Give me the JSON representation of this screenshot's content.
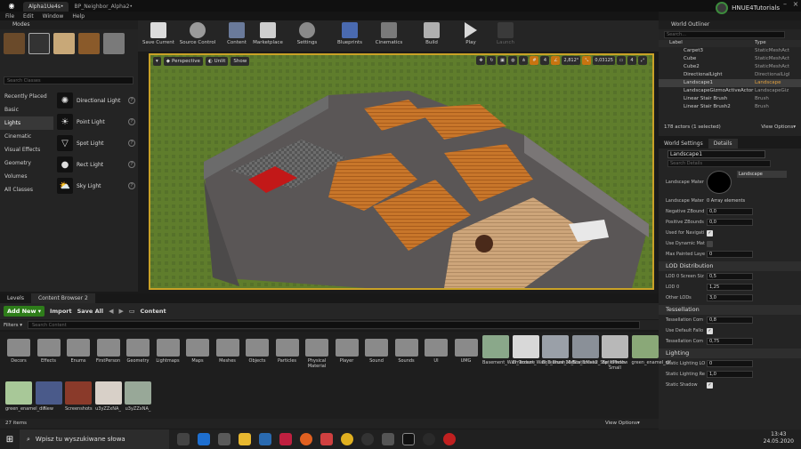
{
  "titlebar": {
    "tab1": "Alpha1Ue4s•",
    "tab2": "BP_Neighbor_Alpha2•",
    "brand": "HNUE4Tutorials"
  },
  "menu": [
    "File",
    "Edit",
    "Window",
    "Help"
  ],
  "modes": {
    "title": "Modes",
    "search_placeholder": "Search Classes",
    "categories": [
      "Recently Placed",
      "Basic",
      "Lights",
      "Cinematic",
      "Visual Effects",
      "Geometry",
      "Volumes",
      "All Classes"
    ],
    "lights": [
      "Directional Light",
      "Point Light",
      "Spot Light",
      "Rect Light",
      "Sky Light"
    ]
  },
  "toolbar": [
    "Save Current",
    "Source Control",
    "Content",
    "Marketplace",
    "Settings",
    "Blueprints",
    "Cinematics",
    "Build",
    "Play",
    "Launch"
  ],
  "viewport": {
    "perspective": "Perspective",
    "lit": "Unlit",
    "show": "Show",
    "angle": "2,812°",
    "scale": "0,03125",
    "cam": "4"
  },
  "outliner": {
    "title": "World Outliner",
    "search_placeholder": "Search...",
    "col_label": "Label",
    "col_type": "Type",
    "rows": [
      {
        "label": "Carpet3",
        "type": "StaticMeshAct"
      },
      {
        "label": "Cube",
        "type": "StaticMeshAct"
      },
      {
        "label": "Cube2",
        "type": "StaticMeshAct"
      },
      {
        "label": "DirectionalLight",
        "type": "DirectionalLigl"
      },
      {
        "label": "Landscape1",
        "type": "Landscape"
      },
      {
        "label": "LandscapeGizmoActiveActor",
        "type": "LandscapeGiz"
      },
      {
        "label": "Linear Stair Brush",
        "type": "Brush"
      },
      {
        "label": "Linear Stair Brush2",
        "type": "Brush"
      }
    ],
    "footer": "178 actors (1 selected)",
    "view_options": "View Options▾"
  },
  "details": {
    "tab1": "World Settings",
    "tab2": "Details",
    "name": "Landscape1",
    "search_placeholder": "Search Details",
    "lm_label": "Landscape Mater",
    "lm_value": "Landscape",
    "lm2_label": "Landscape Mater",
    "lm2_value": "0 Array elements",
    "props": [
      {
        "l": "Negative ZBound",
        "v": "0,0"
      },
      {
        "l": "Positive ZBounds",
        "v": "0,0"
      },
      {
        "l": "Used for Navigati",
        "c": true
      },
      {
        "l": "Use Dynamic Mat",
        "c": false
      },
      {
        "l": "Max Painted Laye",
        "v": "0"
      }
    ],
    "lod_title": "LOD Distribution",
    "lod": [
      {
        "l": "LOD 0 Screen Siz",
        "v": "0,5"
      },
      {
        "l": "LOD 0",
        "v": "1,25"
      },
      {
        "l": "Other LODs",
        "v": "3,0"
      }
    ],
    "tess_title": "Tessellation",
    "tess": [
      {
        "l": "Tessellation Com",
        "v": "0,8"
      },
      {
        "l": "Use Default Fallo",
        "c": true
      },
      {
        "l": "Tessellation Com",
        "v": "0,75"
      }
    ],
    "light_title": "Lighting",
    "light": [
      {
        "l": "Static Lighting LO",
        "v": "0"
      },
      {
        "l": "Static Lighting Re",
        "v": "1,0"
      },
      {
        "l": "Static Shadow",
        "c": true
      }
    ]
  },
  "bottom": {
    "tab1": "Levels",
    "tab2": "Content Browser 2",
    "add_new": "Add New ▾",
    "import": "Import",
    "save_all": "Save All",
    "path": "Content",
    "filters": "Filters ▾",
    "search_placeholder": "Search Content",
    "items_count": "27 items",
    "view_options": "View Options▾"
  },
  "assets": [
    "Decors",
    "Effects",
    "Enums",
    "FirstPerson",
    "Geometry",
    "Lightmaps",
    "Maps",
    "Meshes",
    "Objects",
    "Particles",
    "Physical Material",
    "Player",
    "Sound",
    "Sounds",
    "UI",
    "UMG",
    "Basement_Wall_Texture",
    "Bmement_Wall_Texture_Mat",
    "Box_Brush18_StaticMesh",
    "Box_Brush2_StaticMesh",
    "Bp_Window Small",
    "green_enamel_dif",
    "green_enamel_dif",
    "New",
    "Screenshots",
    "u3yZZxNA_",
    "u3yZZxNA_"
  ],
  "taskbar": {
    "search": "Wpisz tu wyszukiwane słowa",
    "time": "13:43",
    "date": "24.05.2020"
  }
}
